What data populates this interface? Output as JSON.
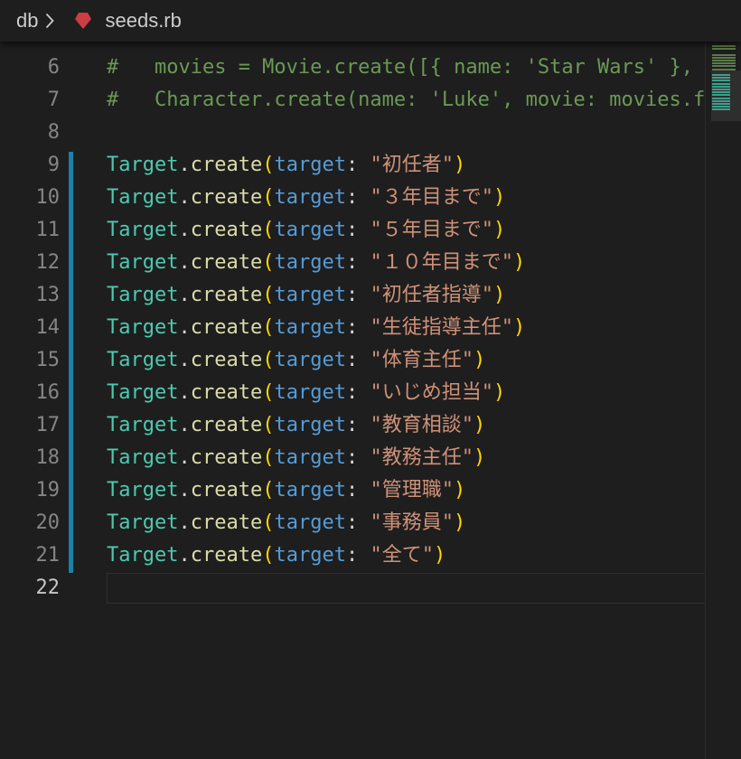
{
  "breadcrumb": {
    "folder": "db",
    "separator_icon": "chevron-right-icon",
    "file_icon": "ruby-icon",
    "file": "seeds.rb"
  },
  "colors": {
    "background": "#1e1e1e",
    "comment": "#6a9955",
    "class": "#4ec9b0",
    "method": "#dcdcaa",
    "bracket": "#ffd700",
    "keyword_arg": "#569cd6",
    "string": "#ce9178",
    "line_number": "#858585",
    "modified_bar": "#1b81a8",
    "ruby_icon": "#cc3e44"
  },
  "editor": {
    "lines": [
      {
        "num": "6",
        "kind": "comment",
        "text": "#   movies = Movie.create([{ name: 'Star Wars' }, { name: 'Lord of the Rings' }])"
      },
      {
        "num": "7",
        "kind": "comment",
        "text": "#   Character.create(name: 'Luke', movie: movies.first)"
      },
      {
        "num": "8",
        "kind": "blank"
      },
      {
        "num": "9",
        "kind": "create",
        "cls": "Target",
        "method": "create",
        "key": "target",
        "value": "\"初任者\""
      },
      {
        "num": "10",
        "kind": "create",
        "cls": "Target",
        "method": "create",
        "key": "target",
        "value": "\"３年目まで\""
      },
      {
        "num": "11",
        "kind": "create",
        "cls": "Target",
        "method": "create",
        "key": "target",
        "value": "\"５年目まで\""
      },
      {
        "num": "12",
        "kind": "create",
        "cls": "Target",
        "method": "create",
        "key": "target",
        "value": "\"１０年目まで\""
      },
      {
        "num": "13",
        "kind": "create",
        "cls": "Target",
        "method": "create",
        "key": "target",
        "value": "\"初任者指導\""
      },
      {
        "num": "14",
        "kind": "create",
        "cls": "Target",
        "method": "create",
        "key": "target",
        "value": "\"生徒指導主任\""
      },
      {
        "num": "15",
        "kind": "create",
        "cls": "Target",
        "method": "create",
        "key": "target",
        "value": "\"体育主任\""
      },
      {
        "num": "16",
        "kind": "create",
        "cls": "Target",
        "method": "create",
        "key": "target",
        "value": "\"いじめ担当\""
      },
      {
        "num": "17",
        "kind": "create",
        "cls": "Target",
        "method": "create",
        "key": "target",
        "value": "\"教育相談\""
      },
      {
        "num": "18",
        "kind": "create",
        "cls": "Target",
        "method": "create",
        "key": "target",
        "value": "\"教務主任\""
      },
      {
        "num": "19",
        "kind": "create",
        "cls": "Target",
        "method": "create",
        "key": "target",
        "value": "\"管理職\""
      },
      {
        "num": "20",
        "kind": "create",
        "cls": "Target",
        "method": "create",
        "key": "target",
        "value": "\"事務員\""
      },
      {
        "num": "21",
        "kind": "create",
        "cls": "Target",
        "method": "create",
        "key": "target",
        "value": "\"全て\""
      },
      {
        "num": "22",
        "kind": "blank",
        "current": true
      }
    ]
  }
}
